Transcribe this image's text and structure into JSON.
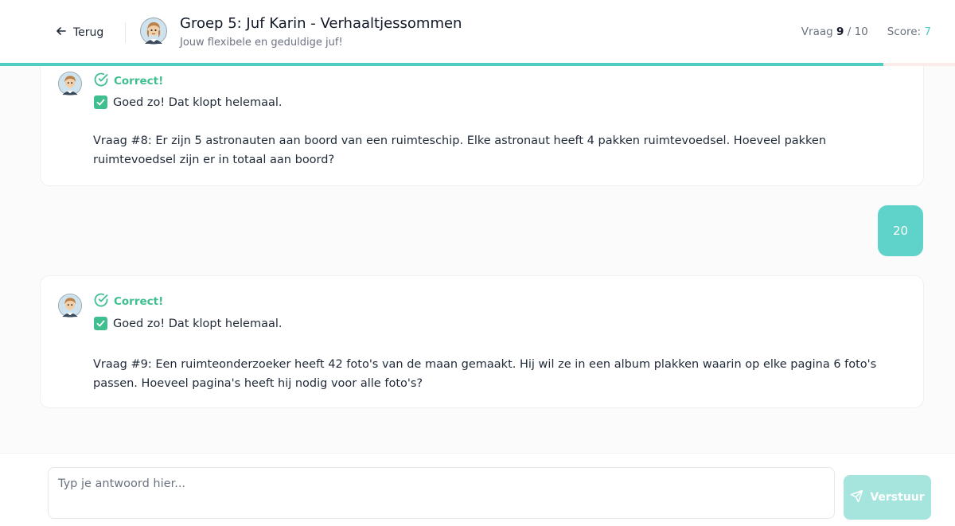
{
  "header": {
    "back_label": "Terug",
    "title": "Groep 5: Juf Karin - Verhaaltjessommen",
    "subtitle": "Jouw flexibele en geduldige juf!",
    "question_label": "Vraag",
    "question_current": "9",
    "question_separator": "/",
    "question_total": "10",
    "score_label": "Score:",
    "score_value": "7",
    "progress_fraction": 0.925
  },
  "messages": [
    {
      "role": "teacher",
      "status": "Correct!",
      "feedback": "Goed zo! Dat klopt helemaal.",
      "question": "Vraag #8: Er zijn 5 astronauten aan boord van een ruimteschip. Elke astronaut heeft 4 pakken ruimtevoedsel. Hoeveel pakken ruimtevoedsel zijn er in totaal aan boord?"
    },
    {
      "role": "user",
      "text": "20"
    },
    {
      "role": "teacher",
      "status": "Correct!",
      "feedback": "Goed zo! Dat klopt helemaal.",
      "question": "Vraag #9: Een ruimteonderzoeker heeft 42 foto's van de maan gemaakt. Hij wil ze in een album plakken waarin op elke pagina 6 foto's passen. Hoeveel pagina's heeft hij nodig voor alle foto's?"
    }
  ],
  "input": {
    "placeholder": "Typ je antwoord hier...",
    "value": ""
  },
  "send_label": "Verstuur",
  "colors": {
    "accent": "#4ecdc4",
    "user_bubble": "#5fd3c9",
    "correct": "#3fbf8f",
    "send_disabled": "#a6e4de",
    "progress_track": "#fdecea"
  }
}
